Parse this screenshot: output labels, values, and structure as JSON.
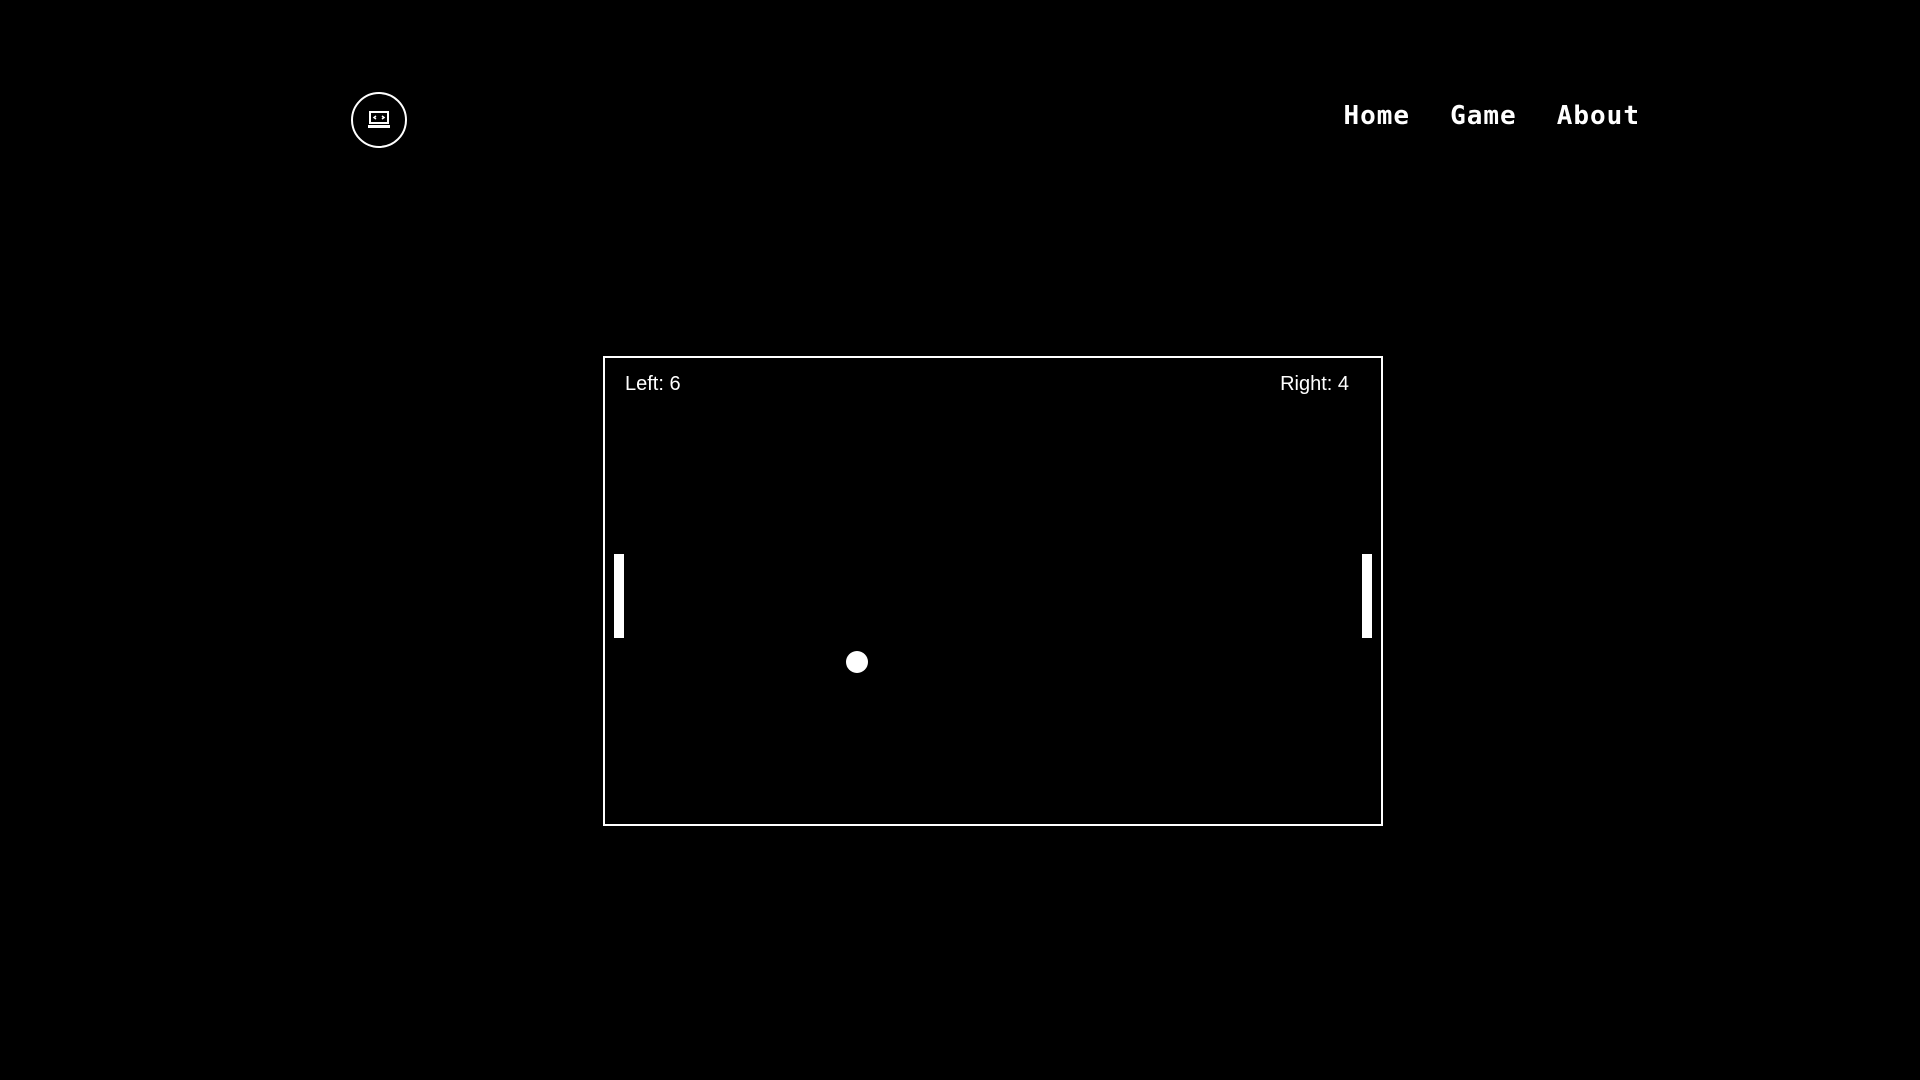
{
  "header": {
    "logo_icon": "arcade-screen-icon",
    "nav": [
      {
        "label": "Home"
      },
      {
        "label": "Game"
      },
      {
        "label": "About"
      }
    ]
  },
  "game": {
    "score_left": "Left: 6",
    "score_right": "Right: 4",
    "left_score_value": 6,
    "right_score_value": 4
  },
  "colors": {
    "background": "#000000",
    "foreground": "#ffffff"
  }
}
